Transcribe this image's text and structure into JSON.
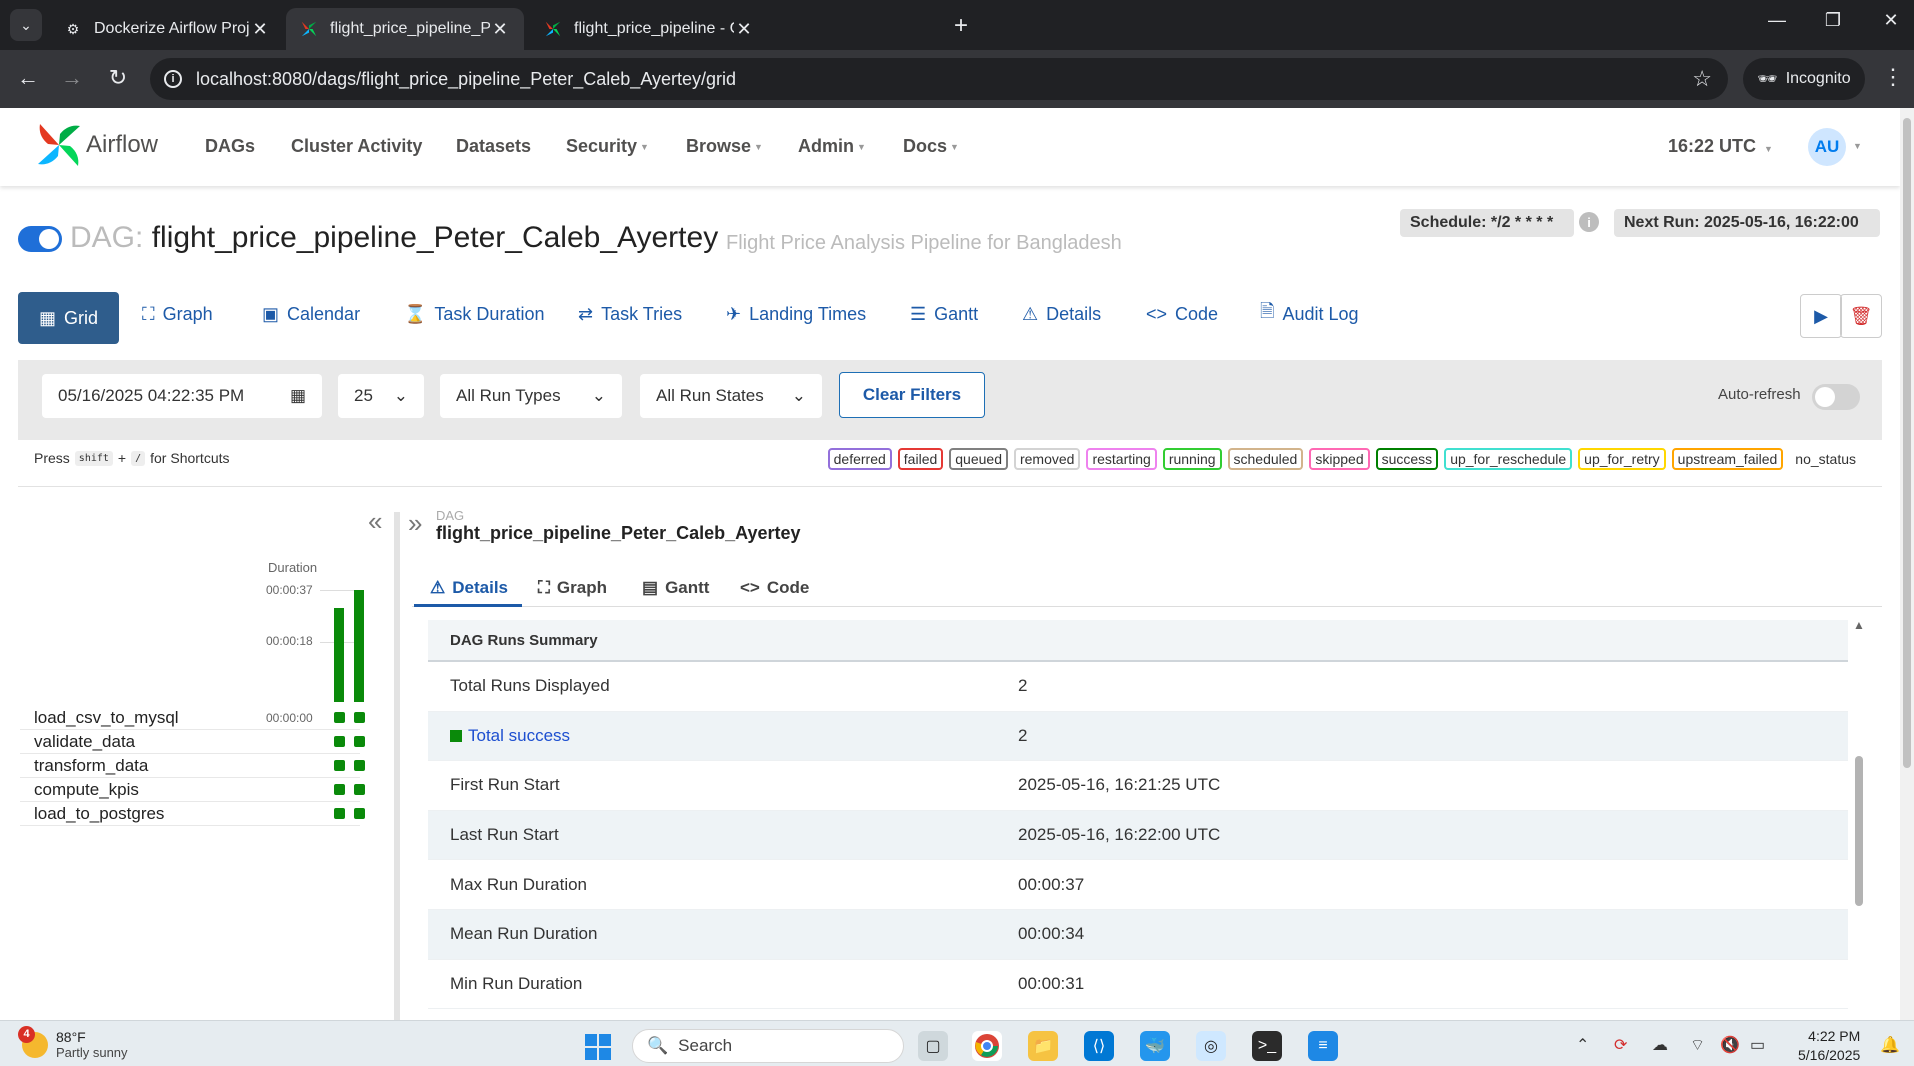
{
  "browser": {
    "tabs": [
      {
        "title": "Dockerize Airflow Project",
        "active": false
      },
      {
        "title": "flight_price_pipeline_Peter_Caleb_Ayertey",
        "active": true
      },
      {
        "title": "flight_price_pipeline - Grid - Airflow",
        "active": false
      }
    ],
    "url": "localhost:8080/dags/flight_price_pipeline_Peter_Caleb_Ayertey/grid",
    "incognito_label": "Incognito"
  },
  "nav": {
    "logo": "Airflow",
    "items": [
      "DAGs",
      "Cluster Activity",
      "Datasets",
      "Security",
      "Browse",
      "Admin",
      "Docs"
    ],
    "time": "16:22 UTC",
    "avatar": "AU"
  },
  "dag": {
    "prefix": "DAG:",
    "id": "flight_price_pipeline_Peter_Caleb_Ayertey",
    "description": "Flight Price Analysis Pipeline for Bangladesh",
    "schedule": "Schedule: */2 * * * *",
    "next_run": "Next Run: 2025-05-16, 16:22:00",
    "paused": false
  },
  "views": [
    "Grid",
    "Graph",
    "Calendar",
    "Task Duration",
    "Task Tries",
    "Landing Times",
    "Gantt",
    "Details",
    "Code",
    "Audit Log"
  ],
  "filters": {
    "date": "05/16/2025 04:22:35 PM",
    "num_runs": "25",
    "run_type": "All Run Types",
    "run_state": "All Run States",
    "clear_label": "Clear Filters",
    "auto_refresh_label": "Auto-refresh",
    "auto_refresh": false
  },
  "shortcuts": {
    "press": "Press",
    "key1": "shift",
    "plus": "+",
    "key2": "/",
    "suffix": "for Shortcuts"
  },
  "legend": [
    {
      "label": "deferred",
      "color": "#9370db"
    },
    {
      "label": "failed",
      "color": "#e53935"
    },
    {
      "label": "queued",
      "color": "#808080"
    },
    {
      "label": "removed",
      "color": "#d3d3d3"
    },
    {
      "label": "restarting",
      "color": "#ee82ee"
    },
    {
      "label": "running",
      "color": "#32cd32"
    },
    {
      "label": "scheduled",
      "color": "#d2b48c"
    },
    {
      "label": "skipped",
      "color": "#ff69b4"
    },
    {
      "label": "success",
      "color": "#008000"
    },
    {
      "label": "up_for_reschedule",
      "color": "#40e0d0"
    },
    {
      "label": "up_for_retry",
      "color": "#ffd700"
    },
    {
      "label": "upstream_failed",
      "color": "#ffa500"
    },
    {
      "label": "no_status",
      "color": "transparent"
    }
  ],
  "grid": {
    "duration_label": "Duration",
    "ticks": [
      "00:00:37",
      "00:00:18",
      "00:00:00"
    ],
    "run_durations_sec": [
      31,
      37
    ],
    "max_sec": 37,
    "tasks": [
      "load_csv_to_mysql",
      "validate_data",
      "transform_data",
      "compute_kpis",
      "load_to_postgres"
    ],
    "task_states": [
      "success",
      "success"
    ]
  },
  "details": {
    "kicker": "DAG",
    "name": "flight_price_pipeline_Peter_Caleb_Ayertey",
    "tabs": [
      "Details",
      "Graph",
      "Gantt",
      "Code"
    ],
    "summary_title": "DAG Runs Summary",
    "rows": [
      {
        "k": "Total Runs Displayed",
        "v": "2"
      },
      {
        "k": "Total success",
        "v": "2"
      },
      {
        "k": "First Run Start",
        "v": "2025-05-16, 16:21:25 UTC"
      },
      {
        "k": "Last Run Start",
        "v": "2025-05-16, 16:22:00 UTC"
      },
      {
        "k": "Max Run Duration",
        "v": "00:00:37"
      },
      {
        "k": "Mean Run Duration",
        "v": "00:00:34"
      },
      {
        "k": "Min Run Duration",
        "v": "00:00:31"
      }
    ]
  },
  "taskbar": {
    "temp": "88°F",
    "weather": "Partly sunny",
    "weather_badge": "4",
    "search": "Search",
    "time": "4:22 PM",
    "date": "5/16/2025"
  }
}
